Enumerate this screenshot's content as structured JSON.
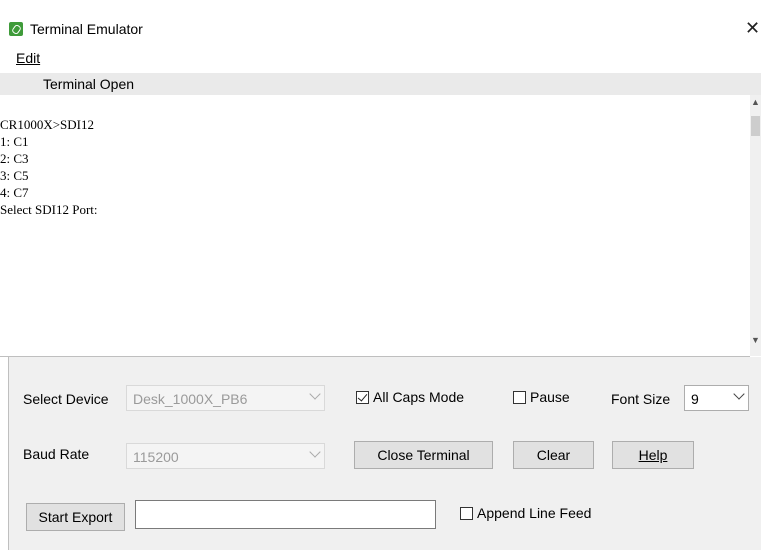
{
  "window": {
    "title": "Terminal Emulator",
    "close_glyph": "✕"
  },
  "menu": {
    "edit_label": "Edit"
  },
  "status": {
    "text": "Terminal Open"
  },
  "terminal": {
    "lines": [
      "CR1000X>SDI12",
      "1: C1",
      "2: C3",
      "3: C5",
      "4: C7",
      "Select SDI12 Port:"
    ]
  },
  "controls": {
    "select_device_label": "Select Device",
    "select_device_value": "Desk_1000X_PB6",
    "all_caps_label": "All Caps Mode",
    "all_caps_checked": true,
    "pause_label": "Pause",
    "pause_checked": false,
    "font_size_label": "Font Size",
    "font_size_value": "9",
    "baud_rate_label": "Baud Rate",
    "baud_rate_value": "115200",
    "close_terminal_label": "Close Terminal",
    "clear_label": "Clear",
    "help_label": "Help",
    "start_export_label": "Start Export",
    "export_path_value": "",
    "append_line_feed_label": "Append Line Feed",
    "append_line_feed_checked": false
  },
  "icons": {
    "app": "app-icon",
    "close": "close-icon",
    "scroll_up": "chevron-up-icon",
    "scroll_down": "chevron-down-icon"
  }
}
